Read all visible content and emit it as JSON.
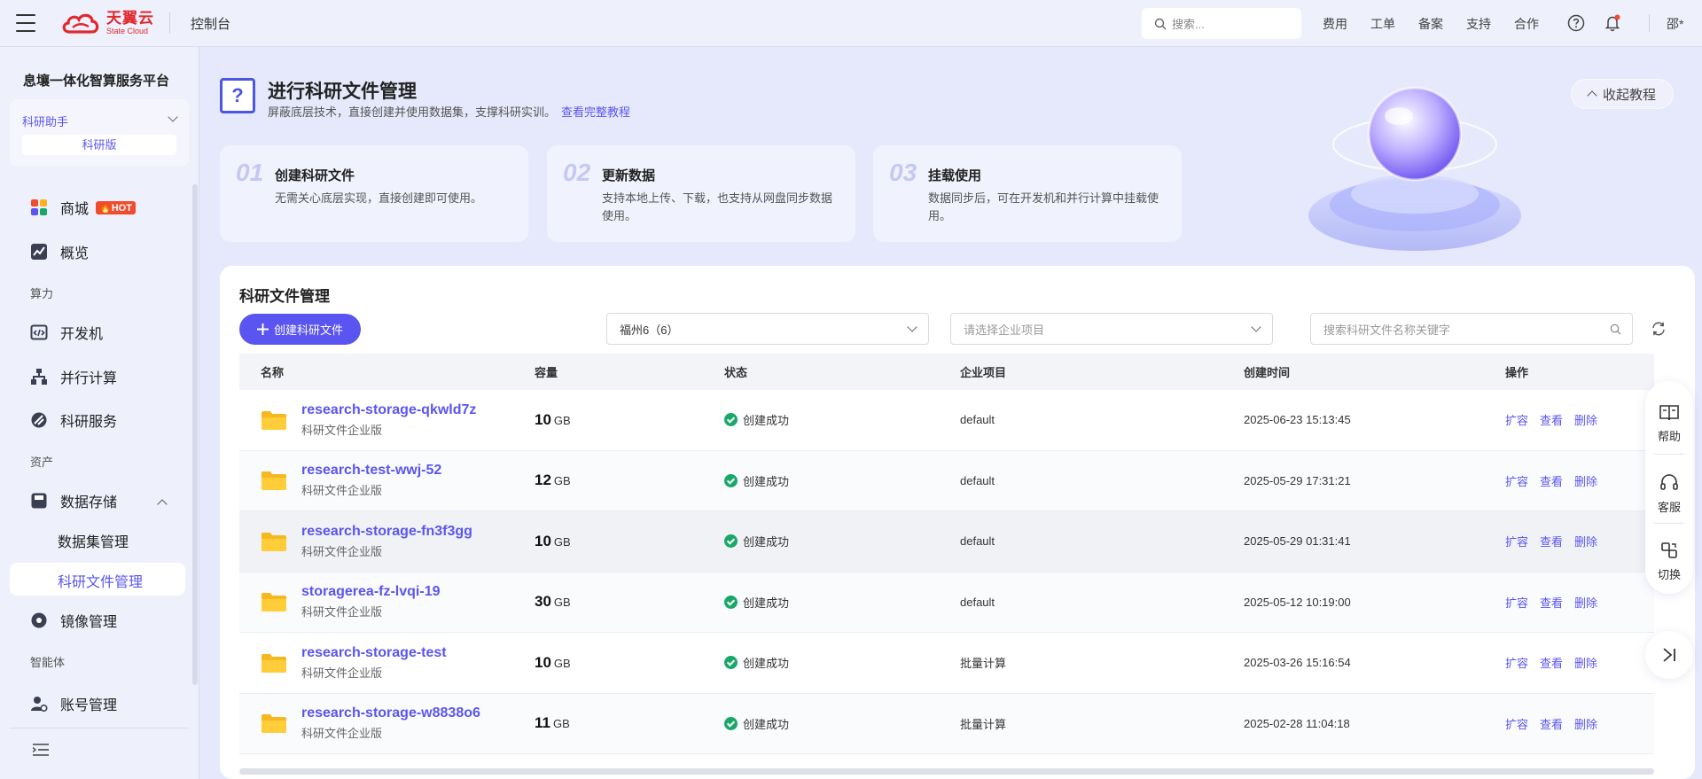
{
  "header": {
    "logo_cn": "天翼云",
    "logo_en": "State Cloud",
    "console_title": "控制台",
    "search_placeholder": "搜索...",
    "links": [
      "费用",
      "工单",
      "备案",
      "支持",
      "合作"
    ],
    "user": "邵*"
  },
  "sidebar": {
    "platform_title": "息壤一体化智算服务平台",
    "assistant": {
      "name": "科研助手",
      "edition": "科研版"
    },
    "items": {
      "mall": "商城",
      "hot": "HOT",
      "overview": "概览",
      "section_compute": "算力",
      "devmachine": "开发机",
      "parallel": "并行计算",
      "research_service": "科研服务",
      "section_assets": "资产",
      "data_storage": "数据存储",
      "dataset_mgmt": "数据集管理",
      "research_file_mgmt": "科研文件管理",
      "image_mgmt": "镜像管理",
      "section_agent": "智能体",
      "account_mgmt": "账号管理"
    }
  },
  "guide": {
    "title": "进行科研文件管理",
    "desc": "屏蔽底层技术，直接创建并使用数据集，支撑科研实训。",
    "link": "查看完整教程",
    "collapse": "收起教程",
    "steps": [
      {
        "num": "01",
        "title": "创建科研文件",
        "desc": "无需关心底层实现，直接创建即可使用。"
      },
      {
        "num": "02",
        "title": "更新数据",
        "desc": "支持本地上传、下载，也支持从网盘同步数据使用。"
      },
      {
        "num": "03",
        "title": "挂载使用",
        "desc": "数据同步后，可在开发机和并行计算中挂载使用。"
      }
    ]
  },
  "panel": {
    "title": "科研文件管理",
    "create_button": "创建科研文件",
    "region_select": "福州6（6）",
    "project_placeholder": "请选择企业项目",
    "search_placeholder": "搜索科研文件名称关键字",
    "columns": [
      "名称",
      "容量",
      "状态",
      "企业项目",
      "创建时间",
      "操作"
    ],
    "rows": [
      {
        "name": "research-storage-qkwld7z",
        "edition": "科研文件企业版",
        "capacity": "10",
        "unit": "GB",
        "status": "创建成功",
        "project": "default",
        "created": "2025-06-23 15:13:45"
      },
      {
        "name": "research-test-wwj-52",
        "edition": "科研文件企业版",
        "capacity": "12",
        "unit": "GB",
        "status": "创建成功",
        "project": "default",
        "created": "2025-05-29 17:31:21"
      },
      {
        "name": "research-storage-fn3f3gg",
        "edition": "科研文件企业版",
        "capacity": "10",
        "unit": "GB",
        "status": "创建成功",
        "project": "default",
        "created": "2025-05-29 01:31:41"
      },
      {
        "name": "storagerea-fz-lvqi-19",
        "edition": "科研文件企业版",
        "capacity": "30",
        "unit": "GB",
        "status": "创建成功",
        "project": "default",
        "created": "2025-05-12 10:19:00"
      },
      {
        "name": "research-storage-test",
        "edition": "科研文件企业版",
        "capacity": "10",
        "unit": "GB",
        "status": "创建成功",
        "project": "批量计算",
        "created": "2025-03-26 15:16:54"
      },
      {
        "name": "research-storage-w8838o6",
        "edition": "科研文件企业版",
        "capacity": "11",
        "unit": "GB",
        "status": "创建成功",
        "project": "批量计算",
        "created": "2025-02-28 11:04:18"
      }
    ],
    "ops": [
      "扩容",
      "查看",
      "删除"
    ]
  },
  "float": {
    "help": "帮助",
    "service": "客服",
    "switch": "切换"
  },
  "colors": {
    "accent": "#5a55f0",
    "success": "#1aa86a",
    "brand_red": "#e0282e",
    "hot": "#f04b2c"
  }
}
